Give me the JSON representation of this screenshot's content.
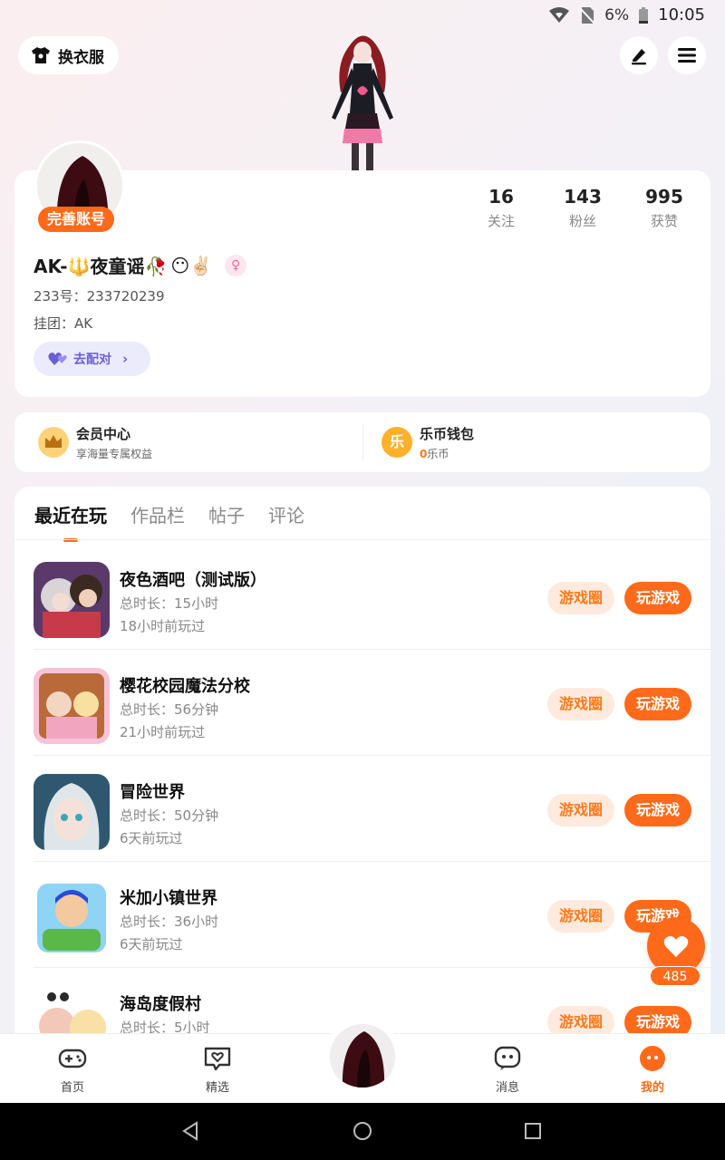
{
  "status_bar": {
    "battery": "6%",
    "time": "10:05"
  },
  "header": {
    "outfit_label": "换衣服"
  },
  "profile": {
    "complete_badge": "完善账号",
    "username": "AK-🔱夜童谣🥀",
    "username_emoji": "😶✌🏻",
    "uid": "233号：233720239",
    "guild": "挂团：AK",
    "pair_label": "去配对",
    "stats": [
      {
        "num": "16",
        "label": "关注"
      },
      {
        "num": "143",
        "label": "粉丝"
      },
      {
        "num": "995",
        "label": "获赞"
      }
    ]
  },
  "vip": {
    "member_title": "会员中心",
    "member_sub": "享海量专属权益",
    "wallet_title": "乐币钱包",
    "wallet_icon_char": "乐",
    "wallet_amount": "0",
    "wallet_unit": "乐币"
  },
  "tabs": [
    {
      "label": "最近在玩",
      "active": true
    },
    {
      "label": "作品栏",
      "active": false
    },
    {
      "label": "帖子",
      "active": false
    },
    {
      "label": "评论",
      "active": false
    }
  ],
  "games": [
    {
      "name": "夜色酒吧（测试版）",
      "duration": "总时长：15小时",
      "last_played": "18小时前玩过"
    },
    {
      "name": " 樱花校园魔法分校",
      "duration": "总时长：56分钟",
      "last_played": "21小时前玩过"
    },
    {
      "name": "冒险世界",
      "duration": "总时长：50分钟",
      "last_played": "6天前玩过"
    },
    {
      "name": "米加小镇世界",
      "duration": "总时长：36小时",
      "last_played": "6天前玩过"
    },
    {
      "name": "海岛度假村",
      "duration": "总时长：5小时",
      "last_played": ""
    }
  ],
  "game_buttons": {
    "circle": "游戏圈",
    "play": "玩游戏"
  },
  "like": {
    "count": "485"
  },
  "bottom_nav": [
    {
      "label": "首页",
      "icon": "gamepad-icon"
    },
    {
      "label": "精选",
      "icon": "heart-chat-icon"
    },
    {
      "label": "消息",
      "icon": "message-icon"
    },
    {
      "label": "我的",
      "icon": "profile-face-icon",
      "active": true
    }
  ],
  "colors": {
    "accent": "#ff6a1a",
    "accent_light": "#ffeadd",
    "pair": "#6b5fd6"
  }
}
